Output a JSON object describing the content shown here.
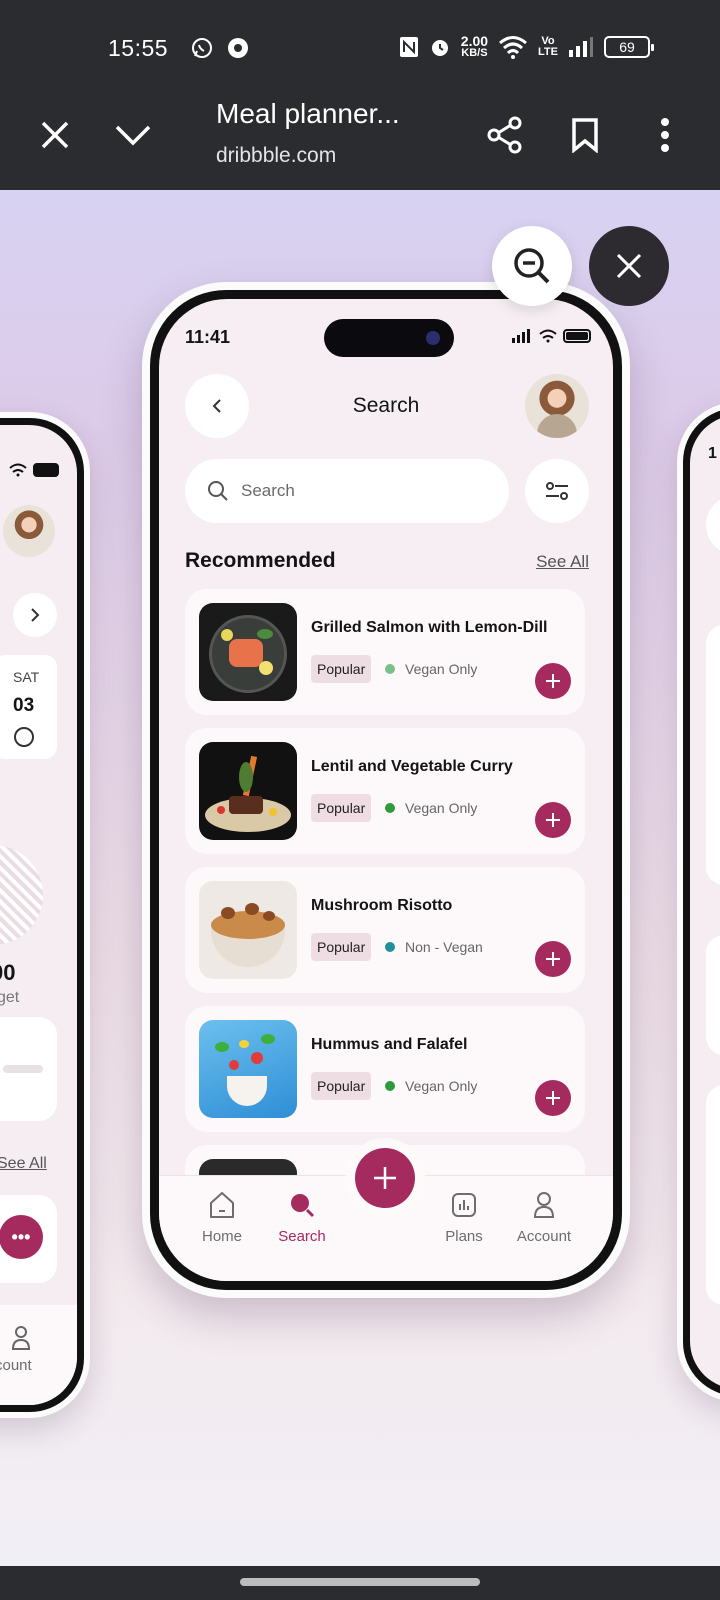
{
  "status_bar": {
    "time": "15:55",
    "net_speed_value": "2.00",
    "net_speed_unit": "KB/S",
    "volte_top": "Vo",
    "volte_bottom": "LTE",
    "battery": "69"
  },
  "browser": {
    "page_title": "Meal planner...",
    "domain": "dribbble.com"
  },
  "phone": {
    "time": "11:41",
    "title": "Search",
    "search_placeholder": "Search",
    "section_title": "Recommended",
    "see_all": "See All",
    "recipes": [
      {
        "name": "Grilled Salmon with Lemon-Dill",
        "tag": "Popular",
        "diet": "Vegan Only",
        "diet_color": "#7bbf8a"
      },
      {
        "name": "Lentil and Vegetable Curry",
        "tag": "Popular",
        "diet": "Vegan Only",
        "diet_color": "#2e9a3c"
      },
      {
        "name": "Mushroom Risotto",
        "tag": "Popular",
        "diet": "Non - Vegan",
        "diet_color": "#1f8f9a"
      },
      {
        "name": "Hummus and Falafel",
        "tag": "Popular",
        "diet": "Vegan Only",
        "diet_color": "#2e9a3c"
      }
    ],
    "tabs": {
      "home": "Home",
      "search": "Search",
      "plans": "Plans",
      "account": "Account"
    },
    "accent_color": "#a52a5e"
  },
  "left_phone": {
    "day": "SAT",
    "date": "03",
    "big_value": "00",
    "caption": "get",
    "see_all": "See All",
    "account": "count"
  },
  "right_phone": {
    "partial_time": "1"
  }
}
